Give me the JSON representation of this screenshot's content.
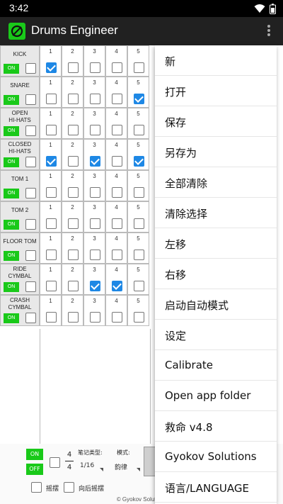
{
  "status": {
    "time": "3:42"
  },
  "app": {
    "title": "Drums Engineer"
  },
  "steps": [
    "1",
    "2",
    "3",
    "4",
    "5"
  ],
  "tracks": [
    {
      "name": "KICK",
      "on": "ON",
      "checks": [
        true,
        false,
        false,
        false,
        false
      ]
    },
    {
      "name": "SNARE",
      "on": "ON",
      "checks": [
        false,
        false,
        false,
        false,
        true
      ]
    },
    {
      "name": "OPEN\nHI-HATS",
      "on": "ON",
      "checks": [
        false,
        false,
        false,
        false,
        false
      ]
    },
    {
      "name": "CLOSED\nHI-HATS",
      "on": "ON",
      "checks": [
        true,
        false,
        true,
        false,
        true
      ]
    },
    {
      "name": "TOM 1",
      "on": "ON",
      "checks": [
        false,
        false,
        false,
        false,
        false
      ]
    },
    {
      "name": "TOM 2",
      "on": "ON",
      "checks": [
        false,
        false,
        false,
        false,
        false
      ]
    },
    {
      "name": "FLOOR TOM",
      "on": "ON",
      "checks": [
        false,
        false,
        false,
        false,
        false
      ]
    },
    {
      "name": "RIDE\nCYMBAL",
      "on": "ON",
      "checks": [
        false,
        false,
        true,
        true,
        false
      ]
    },
    {
      "name": "CRASH\nCYMBAL",
      "on": "ON",
      "checks": [
        false,
        false,
        false,
        false,
        false
      ]
    }
  ],
  "bottom": {
    "on_label": "ON",
    "off_label": "OFF",
    "ts_top": "4",
    "ts_bottom": "4",
    "note_type_label": "笔记类型:",
    "note_type_value": "1/16",
    "mode_label": "模式:",
    "mode_value": "韵律",
    "swing_label": "摇摆",
    "back_swing_label": "向后摇摆",
    "copyright": "© Gyokov Solutions"
  },
  "menu": {
    "items": [
      "新",
      "打开",
      "保存",
      "另存为",
      "全部清除",
      "清除选择",
      "左移",
      "右移",
      "启动自动模式",
      "设定",
      "Calibrate",
      "Open app folder",
      "救命 v4.8",
      "Gyokov Solutions",
      "语言/LANGUAGE"
    ]
  },
  "colors": {
    "accent": "#1e88e5",
    "on_green": "#19c919",
    "appbar": "#212121"
  }
}
